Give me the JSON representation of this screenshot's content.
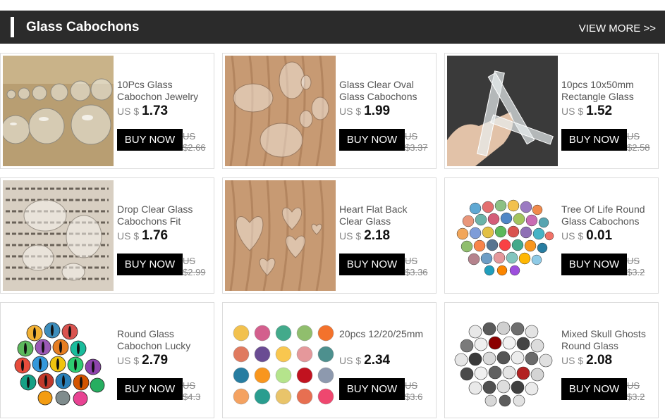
{
  "header": {
    "title": "Glass Cabochons",
    "view_more": "VIEW MORE >>"
  },
  "buy_label": "BUY NOW",
  "currency": "US $",
  "products": [
    {
      "name": "10Pcs Glass Cabochon Jewelry",
      "price": "1.73",
      "old_currency": "US",
      "old_price": "$2.66",
      "image": "clear-round-cabochons"
    },
    {
      "name": "Glass Clear Oval Glass Cabochons",
      "price": "1.99",
      "old_currency": "US",
      "old_price": "$3.37",
      "image": "clear-oval-cabochons"
    },
    {
      "name": "10pcs 10x50mm Rectangle Glass",
      "price": "1.52",
      "old_currency": "US",
      "old_price": "$2.58",
      "image": "rectangle-glass-in-hand"
    },
    {
      "name": "Drop Clear Glass Cabochons Fit",
      "price": "1.76",
      "old_currency": "US",
      "old_price": "$2.99",
      "image": "drop-cabochons-on-text"
    },
    {
      "name": "Heart Flat Back Clear Glass",
      "price": "2.18",
      "old_currency": "US",
      "old_price": "$3.36",
      "image": "heart-cabochons"
    },
    {
      "name": "Tree Of Life Round Glass Cabochons",
      "price": "0.01",
      "old_currency": "US",
      "old_price": "$3.2",
      "image": "tree-of-life-cabochons"
    },
    {
      "name": "Round Glass Cabochon Lucky",
      "price": "2.79",
      "old_currency": "US",
      "old_price": "$4.3",
      "image": "eye-cabochons"
    },
    {
      "name": "20pcs 12/20/25mm",
      "price": "2.34",
      "old_currency": "US",
      "old_price": "$3.6",
      "image": "pattern-cabochons-grid"
    },
    {
      "name": "Mixed Skull Ghosts Round Glass",
      "price": "2.08",
      "old_currency": "US",
      "old_price": "$3.2",
      "image": "skull-cabochons"
    }
  ]
}
